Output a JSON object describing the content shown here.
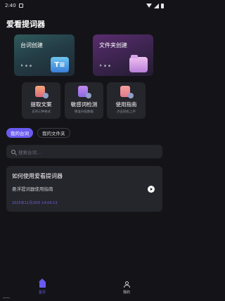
{
  "status_bar": {
    "time": "2:40"
  },
  "app": {
    "title": "爱看提词器"
  },
  "hero_cards": [
    {
      "label": "台词创建",
      "icon": "document-icon",
      "icon_glyph": "T≡"
    },
    {
      "label": "文件夹创建",
      "icon": "folder-icon"
    }
  ],
  "tools": [
    {
      "title": "提取文案",
      "subtitle": "支持三种格式",
      "icon": "extract-icon"
    },
    {
      "title": "敏感词检测",
      "subtitle": "精准扫描数据",
      "icon": "sensitive-check-icon"
    },
    {
      "title": "使用指南",
      "subtitle": "点击轻松上手",
      "icon": "guide-icon"
    }
  ],
  "tabs": [
    {
      "label": "我的台词",
      "active": true
    },
    {
      "label": "我的文件夹",
      "active": false
    }
  ],
  "search": {
    "placeholder": "搜索台词..."
  },
  "script_list": [
    {
      "title": "如何使用爱看提词器",
      "description": "悬浮提词器使用指南",
      "timestamp": "2025年11月29日 14:04:13"
    }
  ],
  "bottom_nav": [
    {
      "label": "首页",
      "active": true
    },
    {
      "label": "我的",
      "active": false
    }
  ],
  "colors": {
    "accent": "#6a5af0",
    "background": "#141418",
    "card": "#25252c"
  }
}
